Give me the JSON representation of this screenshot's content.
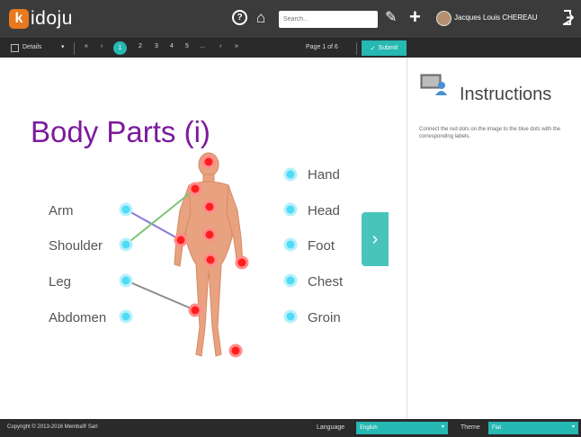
{
  "header": {
    "logo_letter": "k",
    "logo_text": "idoju",
    "search_placeholder": "Search...",
    "user_name": "Jacques Louis CHEREAU"
  },
  "toolbar": {
    "details_label": "Details",
    "pages": [
      "1",
      "2",
      "3",
      "4",
      "5",
      "..."
    ],
    "page_info": "Page 1 of 6",
    "submit_label": "Submit"
  },
  "activity": {
    "title": "Body Parts (i)",
    "left_labels": [
      "Arm",
      "Shoulder",
      "Leg",
      "Abdomen"
    ],
    "right_labels": [
      "Hand",
      "Head",
      "Foot",
      "Chest",
      "Groin"
    ]
  },
  "instructions": {
    "title": "Instructions",
    "text": "Connect the red dots on the image to the blue dots with the corresponding labels."
  },
  "footer": {
    "copyright": "Copyright © 2013-2016 Memba® Sarl",
    "language_label": "Language",
    "language_value": "English",
    "theme_label": "Theme",
    "theme_value": "Flat"
  },
  "colors": {
    "accent": "#26b8b2",
    "title": "#7b1a9c",
    "topbar": "#3b3b3b"
  }
}
